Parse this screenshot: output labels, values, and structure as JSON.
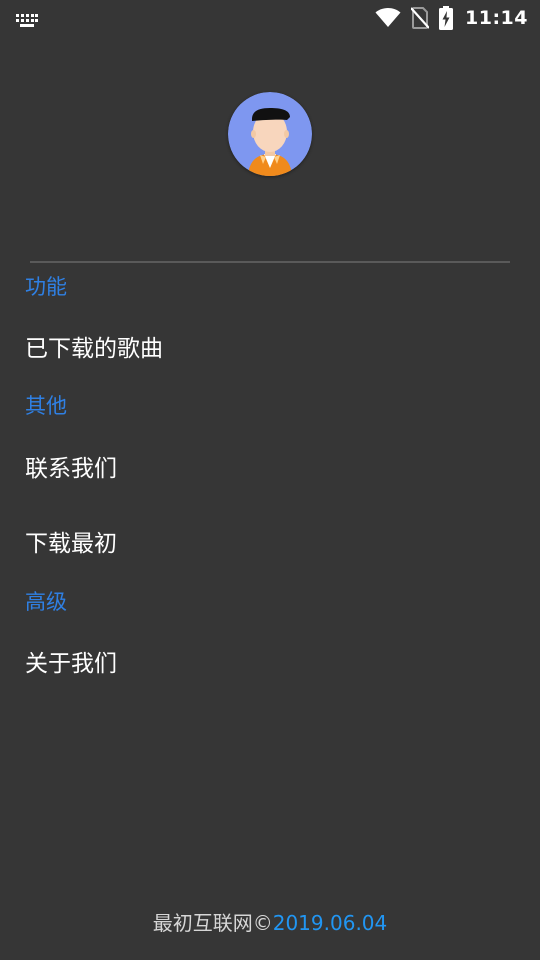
{
  "status_bar": {
    "time": "11:14",
    "icons": [
      "keyboard-icon",
      "wifi-icon",
      "no-sim-icon",
      "battery-charging-icon"
    ]
  },
  "profile": {
    "avatar_icon": "user-avatar-icon"
  },
  "sections": [
    {
      "header": "功能",
      "items": [
        "已下载的歌曲"
      ]
    },
    {
      "header": "其他",
      "items": [
        "联系我们",
        "下载最初"
      ]
    },
    {
      "header": "高级",
      "items": [
        "关于我们"
      ]
    }
  ],
  "footer": {
    "prefix": "最初互联网©",
    "date": "2019.06.04"
  },
  "colors": {
    "background": "#363636",
    "section_header": "#2f80e4",
    "item_text": "#ffffff",
    "footer_text": "#d6d6d6",
    "footer_date": "#2196f3",
    "divider": "#5a5a5a"
  }
}
